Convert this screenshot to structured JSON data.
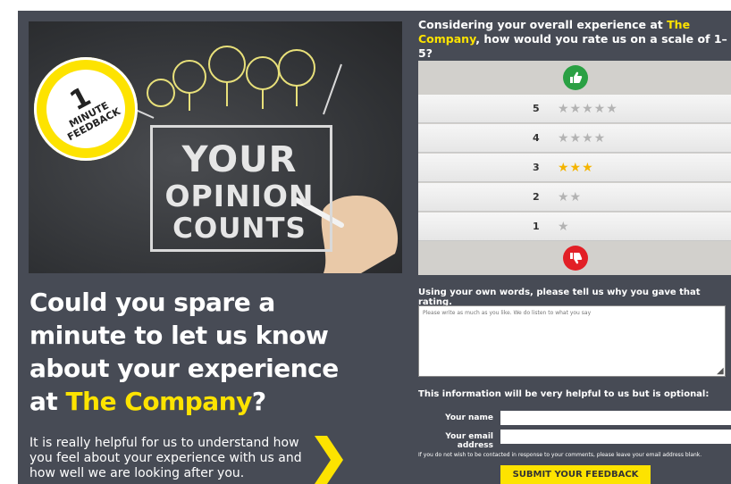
{
  "hero": {
    "badge_number": "1",
    "badge_text": "MINUTE FEEDBACK",
    "chalk_line1": "YOUR",
    "chalk_line2": "OPINION",
    "chalk_line3": "COUNTS"
  },
  "headline": {
    "text": "Could you spare a minute to let us know about your experience at ",
    "company": "The Company",
    "end": "?"
  },
  "subtext": "It is really helpful for us to understand how you feel about your experience with us and how well we are looking after you.",
  "question": {
    "prefix": "Considering your overall experience at ",
    "company": "The Company",
    "suffix": ", how would you rate us on a scale of 1–5?"
  },
  "rating": {
    "rows": [
      {
        "num": "5",
        "filled": 0,
        "total": 5
      },
      {
        "num": "4",
        "filled": 0,
        "total": 4
      },
      {
        "num": "3",
        "filled": 3,
        "total": 3
      },
      {
        "num": "2",
        "filled": 0,
        "total": 2
      },
      {
        "num": "1",
        "filled": 0,
        "total": 1
      }
    ]
  },
  "reason": {
    "label": "Using your own words, please tell us why you gave that rating.",
    "placeholder": "Please write as much as you like. We do listen to what you say"
  },
  "optional": {
    "label": "This information will be very helpful to us but is optional:",
    "name_label": "Your name",
    "email_label": "Your email address",
    "disclaimer": "If you do not wish to be contacted in response to your comments, please leave your email address blank."
  },
  "submit_label": "SUBMIT YOUR FEEDBACK",
  "colors": {
    "accent": "#fde300",
    "panel": "#474b55",
    "thumb_up": "#2aa043",
    "thumb_down": "#e21f26"
  }
}
